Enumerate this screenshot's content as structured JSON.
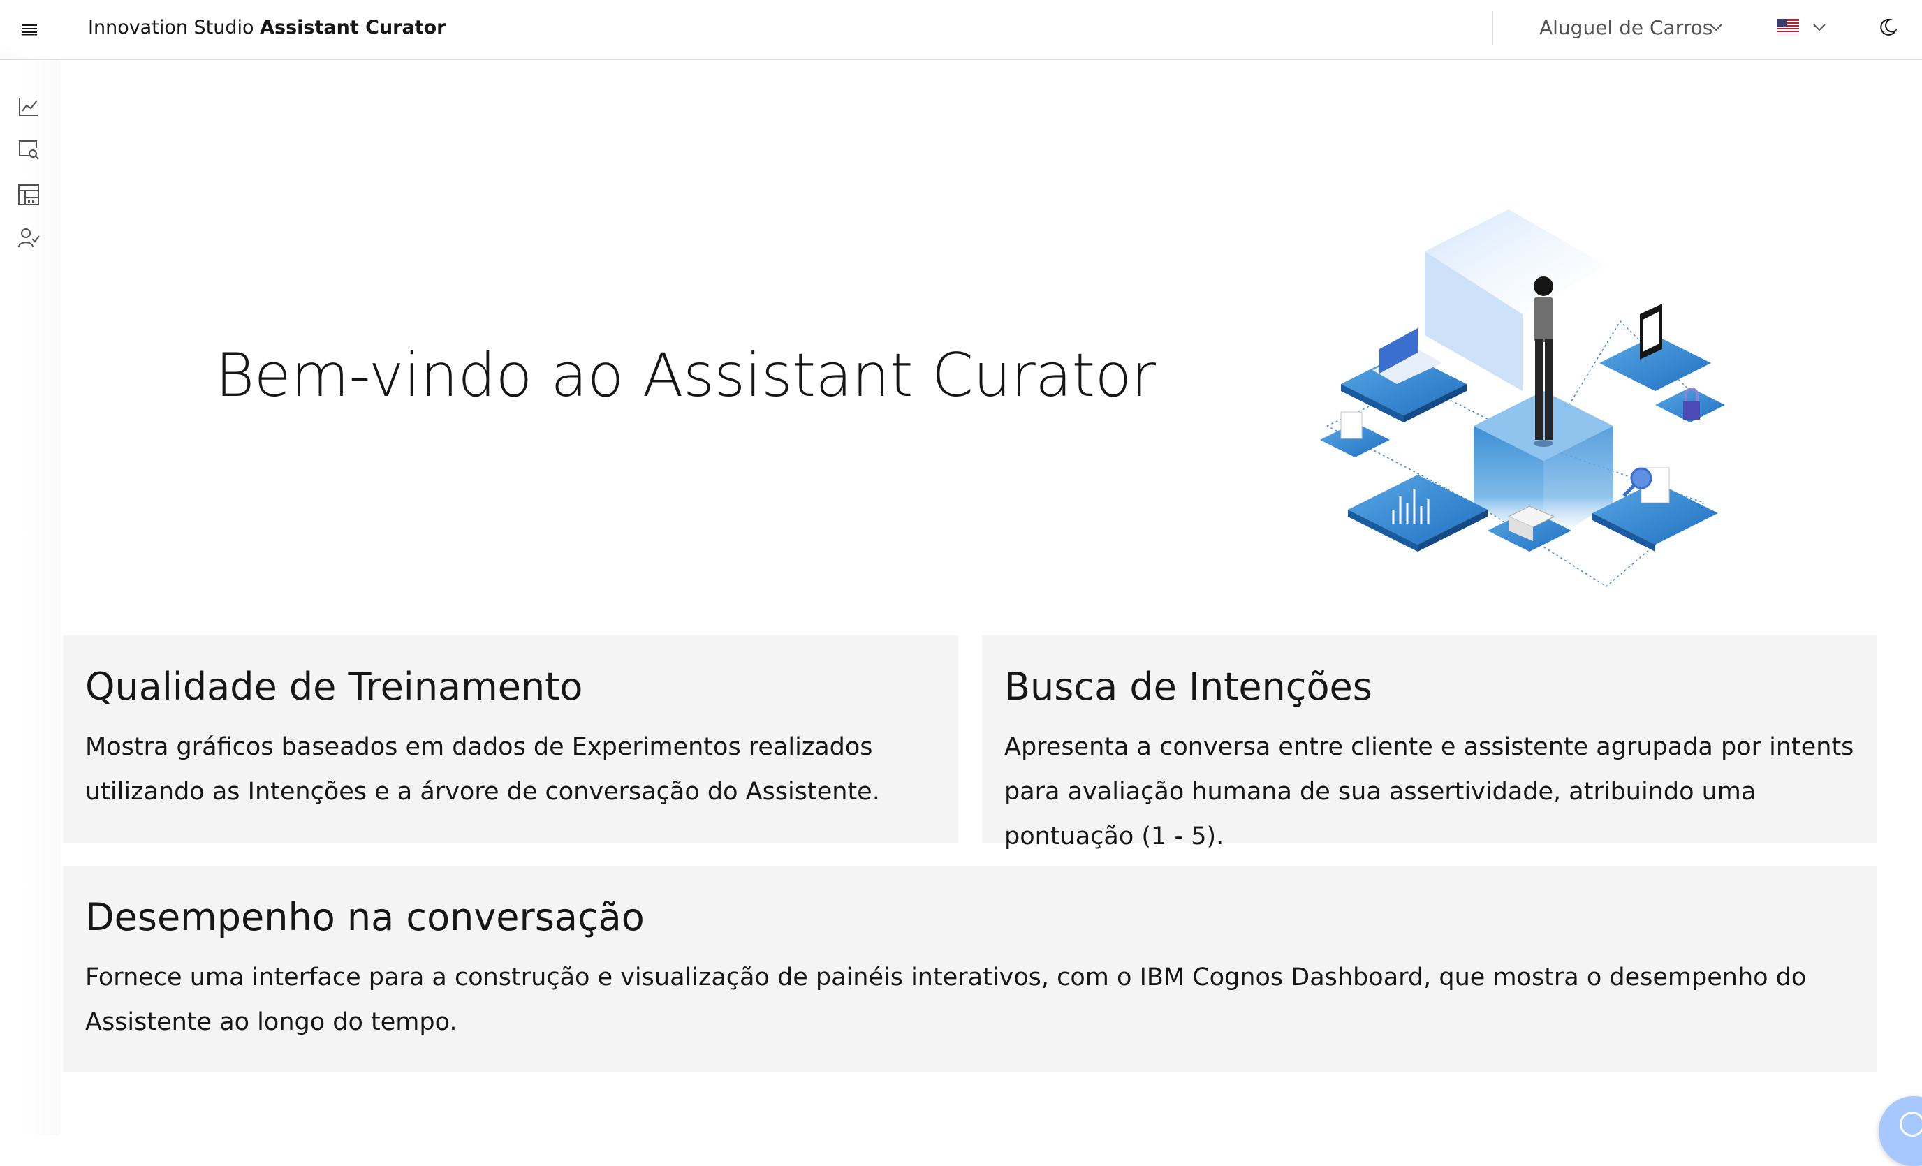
{
  "header": {
    "brand_prefix": "Innovation Studio",
    "brand_name": "Assistant Curator",
    "workspace_selected": "Aluguel de Carros",
    "language_flag": "flag-us-icon",
    "theme_toggle": "moon-icon"
  },
  "rail": {
    "items": [
      {
        "icon": "chart-line-icon"
      },
      {
        "icon": "search-screen-icon"
      },
      {
        "icon": "dashboard-icon"
      },
      {
        "icon": "user-check-icon"
      }
    ]
  },
  "hero": {
    "title": "Bem-vindo ao Assistant Curator"
  },
  "tiles": [
    {
      "title": "Qualidade de Treinamento",
      "description": "Mostra gráficos baseados em dados de Experimentos realizados utilizando as Intenções e a árvore de conversação do Assistente."
    },
    {
      "title": "Busca de Intenções",
      "description": "Apresenta a conversa entre cliente e assistente agrupada por intents para avaliação humana de sua assertividade, atribuindo uma pontuação (1 - 5)."
    },
    {
      "title": "Desempenho na conversação",
      "description": "Fornece uma interface para a construção e visualização de painéis interativos, com o IBM Cognos Dashboard, que mostra o desempenho do Assistente ao longo do tempo."
    }
  ],
  "colors": {
    "accent_blue": "#1f70c1",
    "tile_bg": "#f4f4f4",
    "text": "#161616"
  }
}
